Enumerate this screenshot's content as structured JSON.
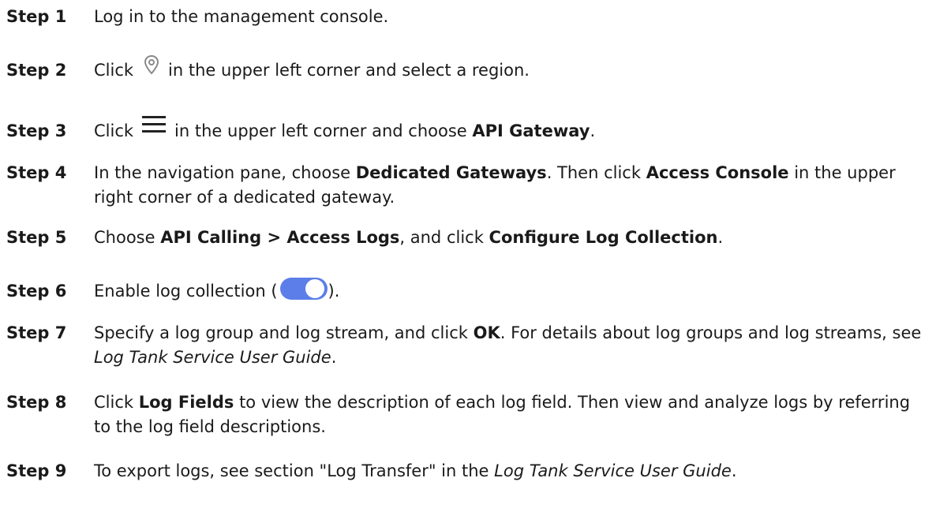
{
  "steps": [
    {
      "label": "Step 1",
      "segments": [
        {
          "t": "Log in to the management console."
        }
      ]
    },
    {
      "label": "Step 2",
      "segments": [
        {
          "t": "Click"
        },
        {
          "icon": "location-pin-icon"
        },
        {
          "t": "in the upper left corner and select a region."
        }
      ]
    },
    {
      "label": "Step 3",
      "segments": [
        {
          "t": "Click"
        },
        {
          "icon": "hamburger-menu-icon"
        },
        {
          "t": "in the upper left corner and choose "
        },
        {
          "t": "API Gateway",
          "b": true
        },
        {
          "t": "."
        }
      ]
    },
    {
      "label": "Step 4",
      "segments": [
        {
          "t": "In the navigation pane, choose "
        },
        {
          "t": "Dedicated Gateways",
          "b": true
        },
        {
          "t": ". Then click "
        },
        {
          "t": "Access Console",
          "b": true
        },
        {
          "t": " in the upper right corner of a dedicated gateway."
        }
      ]
    },
    {
      "label": "Step 5",
      "segments": [
        {
          "t": "Choose "
        },
        {
          "t": "API Calling > Access Logs",
          "b": true
        },
        {
          "t": ", and click "
        },
        {
          "t": "Configure Log Collection",
          "b": true
        },
        {
          "t": "."
        }
      ]
    },
    {
      "label": "Step 6",
      "segments": [
        {
          "t": "Enable log collection ("
        },
        {
          "icon": "toggle-switch-on-icon"
        },
        {
          "t": ")."
        }
      ]
    },
    {
      "label": "Step 7",
      "segments": [
        {
          "t": "Specify a log group and log stream, and click "
        },
        {
          "t": "OK",
          "b": true
        },
        {
          "t": ". For details about log groups and log streams, see "
        },
        {
          "t": "Log Tank Service User Guide",
          "i": true
        },
        {
          "t": "."
        }
      ]
    },
    {
      "label": "Step 8",
      "segments": [
        {
          "t": "Click "
        },
        {
          "t": "Log Fields",
          "b": true
        },
        {
          "t": " to view the description of each log field. Then view and analyze logs by referring to the log field descriptions."
        }
      ]
    },
    {
      "label": "Step 9",
      "segments": [
        {
          "t": "To export logs, see section \"Log Transfer\" in the "
        },
        {
          "t": "Log Tank Service User Guide",
          "i": true
        },
        {
          "t": "."
        }
      ]
    }
  ],
  "colors": {
    "text": "#1a1a1a",
    "icon_gray": "#8a8a8a",
    "icon_dark": "#222222",
    "toggle_on": "#5b7ee8",
    "toggle_knob": "#ffffff"
  }
}
